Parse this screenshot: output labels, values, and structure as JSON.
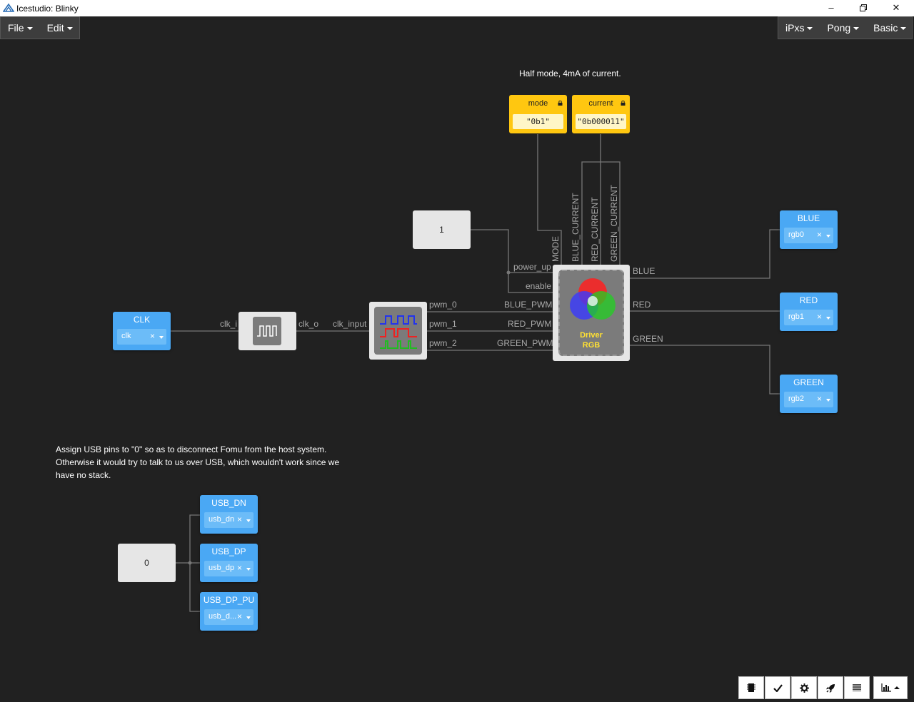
{
  "window": {
    "title": "Icestudio: Blinky"
  },
  "menu_left": [
    "File",
    "Edit"
  ],
  "menu_right": [
    "iPxs",
    "Pong",
    "Basic"
  ],
  "comments": {
    "top": "Half mode, 4mA of current.",
    "usb_lines": [
      "Assign USB pins to \"0\" so as to disconnect Fomu from the host system.",
      "Otherwise it would try to talk to us over USB, which wouldn't work since we",
      "have no stack."
    ]
  },
  "params": {
    "mode": {
      "name": "mode",
      "value": "\"0b1\""
    },
    "current": {
      "name": "current",
      "value": "\"0b000011\""
    }
  },
  "constants": {
    "power": "1",
    "usb": "0"
  },
  "inputs": {
    "clk": {
      "name": "CLK",
      "pin": "clk"
    }
  },
  "outputs": {
    "blue": {
      "name": "BLUE",
      "pin": "rgb0"
    },
    "red": {
      "name": "RED",
      "pin": "rgb1"
    },
    "green": {
      "name": "GREEN",
      "pin": "rgb2"
    },
    "usb_dn": {
      "name": "USB_DN",
      "pin": "usb_dn"
    },
    "usb_dp": {
      "name": "USB_DP",
      "pin": "usb_dp"
    },
    "usb_dp_pu": {
      "name": "USB_DP_PU",
      "pin": "usb_d..."
    }
  },
  "driver": {
    "line1": "Driver",
    "line2": "RGB"
  },
  "ports": {
    "clk_i": "clk_i",
    "clk_o": "clk_o",
    "clk_input": "clk_input",
    "pwm_0": "pwm_0",
    "pwm_1": "pwm_1",
    "pwm_2": "pwm_2",
    "blue_pwm": "BLUE_PWM",
    "red_pwm": "RED_PWM",
    "green_pwm": "GREEN_PWM",
    "power_up": "power_up",
    "enable": "enable",
    "blue": "BLUE",
    "red": "RED",
    "green": "GREEN",
    "mode": "MODE",
    "blue_current": "BLUE_CURRENT",
    "red_current": "RED_CURRENT",
    "green_current": "GREEN_CURRENT"
  },
  "clear_glyph": "×",
  "colors": {
    "background": "#212121",
    "io_block": "#4aa8f4",
    "param_block": "#ffc710",
    "wire": "#777777"
  },
  "toolbar_icons": [
    "chip-icon",
    "check-icon",
    "gear-icon",
    "rocket-icon",
    "list-icon",
    "bar-chart-icon"
  ]
}
